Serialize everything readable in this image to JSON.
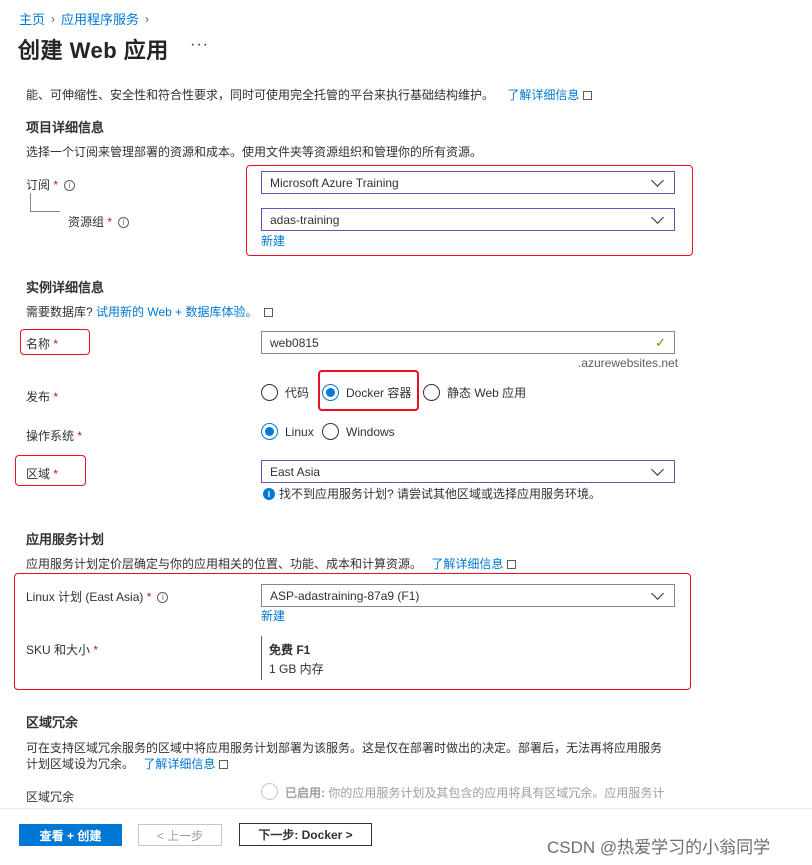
{
  "breadcrumb": {
    "home": "主页",
    "service": "应用程序服务"
  },
  "page_title": "创建 Web 应用",
  "more_label": "···",
  "intro": {
    "text": "能、可伸缩性、安全性和符合性要求，同时可使用完全托管的平台来执行基础结构维护。",
    "link": "了解详细信息"
  },
  "project": {
    "heading": "项目详细信息",
    "desc": "选择一个订阅来管理部署的资源和成本。使用文件夹等资源组织和管理你的所有资源。",
    "subscription_label": "订阅",
    "subscription_value": "Microsoft Azure Training",
    "rg_label": "资源组",
    "rg_value": "adas-training",
    "create_new": "新建"
  },
  "instance": {
    "heading": "实例详细信息",
    "db_prefix": "需要数据库?",
    "db_link": "试用新的 Web + 数据库体验。",
    "name_label": "名称",
    "name_value": "web0815",
    "name_suffix": ".azurewebsites.net",
    "publish_label": "发布",
    "publish_options": [
      "代码",
      "Docker 容器",
      "静态 Web 应用"
    ],
    "os_label": "操作系统",
    "os_options": [
      "Linux",
      "Windows"
    ],
    "region_label": "区域",
    "region_value": "East Asia",
    "region_info": "找不到应用服务计划? 请尝试其他区域或选择应用服务环境。"
  },
  "plan": {
    "heading": "应用服务计划",
    "desc": "应用服务计划定价层确定与你的应用相关的位置、功能、成本和计算资源。",
    "link": "了解详细信息",
    "linux_label": "Linux 计划 (East Asia)",
    "linux_value": "ASP-adastraining-87a9 (F1)",
    "create_new": "新建",
    "sku_label": "SKU 和大小",
    "sku_name": "免费 F1",
    "sku_mem": "1 GB 内存"
  },
  "zone": {
    "heading": "区域冗余",
    "desc1": "可在支持区域冗余服务的区域中将应用服务计划部署为该服务。这是仅在部署时做出的决定。部署后，无法再将应用服务",
    "desc2": "计划区域设为冗余。",
    "link": "了解详细信息",
    "label": "区域冗余",
    "enabled_bold": "已启用:",
    "enabled_text": "你的应用服务计划及其包含的应用将具有区域冗余。应用服务计"
  },
  "footer": {
    "review_create": "查看 + 创建",
    "prev": "< 上一步",
    "next": "下一步: Docker >"
  },
  "watermark": "CSDN @热爱学习的小翁同学",
  "colors": {
    "accent": "#0078d4",
    "highlight": "#e81123",
    "required": "#a4262c",
    "valid": "#57a300"
  }
}
